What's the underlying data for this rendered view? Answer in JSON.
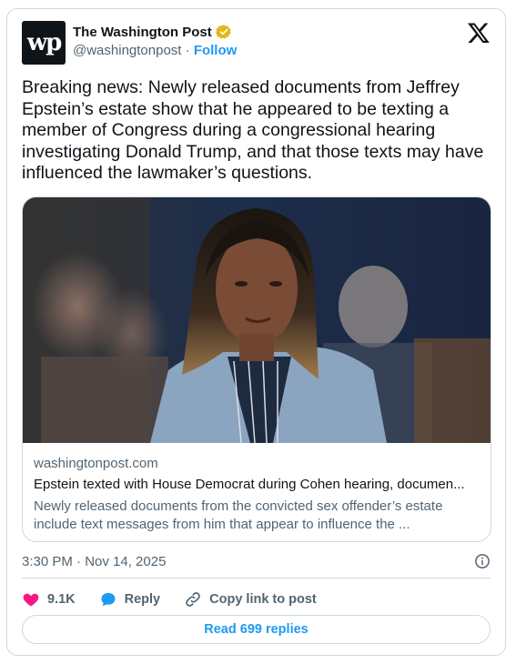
{
  "account": {
    "avatar_text": "wp",
    "name": "The Washington Post",
    "handle": "@washingtonpost",
    "separator": "·",
    "follow_label": "Follow"
  },
  "tweet": {
    "text": "Breaking news: Newly released documents from Jeffrey Epstein’s estate show that he appeared to be texting a member of Congress during a congressional hearing investigating Donald Trump, and that those texts may have influenced the lawmaker’s questions."
  },
  "link_card": {
    "domain": "washingtonpost.com",
    "title": "Epstein texted with House Democrat during Cohen hearing, documen...",
    "description": "Newly released documents from the convicted sex offender’s estate include text messages from him that appear to influence the ..."
  },
  "timestamp": "3:30 PM · Nov 14, 2025",
  "actions": {
    "likes_count": "9.1K",
    "reply_label": "Reply",
    "copy_link_label": "Copy link to post"
  },
  "read_replies_label": "Read 699 replies",
  "colors": {
    "accent": "#1d9bf0",
    "like": "#f91880",
    "verified": "#e2b719",
    "secondary_text": "#536471"
  }
}
